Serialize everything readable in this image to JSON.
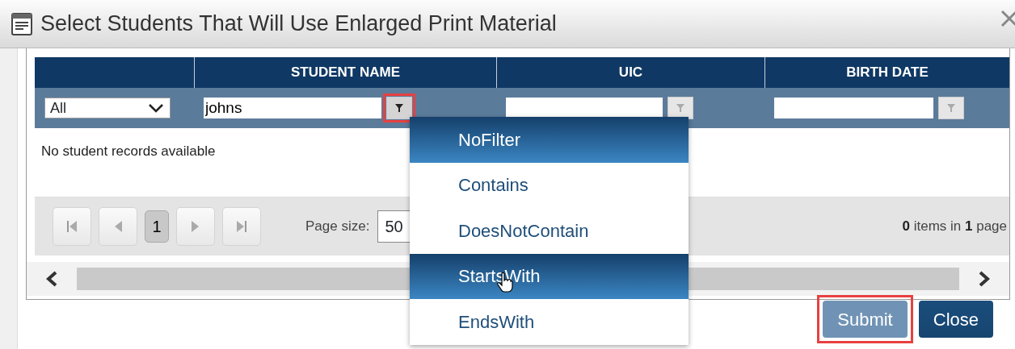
{
  "dialog": {
    "title": "Select Students That Will Use Enlarged Print Material"
  },
  "grid": {
    "columns": [
      {
        "kind": "select",
        "filter_value": "All"
      },
      {
        "kind": "text",
        "label": "STUDENT NAME",
        "filter_value": "johns",
        "filter_button_annotated": true
      },
      {
        "kind": "text",
        "label": "UIC",
        "filter_button_annotated": false
      },
      {
        "kind": "text",
        "label": "BIRTH DATE",
        "filter_button_annotated": false
      }
    ],
    "empty_message": "No student records available",
    "pager": {
      "pages": [
        {
          "label": "1",
          "selected": true
        }
      ],
      "page_size_label": "Page size:",
      "page_size": "50",
      "summary": "**0** items in **1** page"
    }
  },
  "filter_menu": {
    "items": [
      {
        "label": "NoFilter",
        "selected": true,
        "hovered": false
      },
      {
        "label": "Contains",
        "selected": false,
        "hovered": false
      },
      {
        "label": "DoesNotContain",
        "selected": false,
        "hovered": false
      },
      {
        "label": "StartsWith",
        "selected": false,
        "hovered": true
      },
      {
        "label": "EndsWith",
        "selected": false,
        "hovered": false
      }
    ]
  },
  "buttons": [
    {
      "label": "Submit",
      "kind": "secondary",
      "annotated": true
    },
    {
      "label": "Close",
      "kind": "primary",
      "annotated": false
    }
  ]
}
